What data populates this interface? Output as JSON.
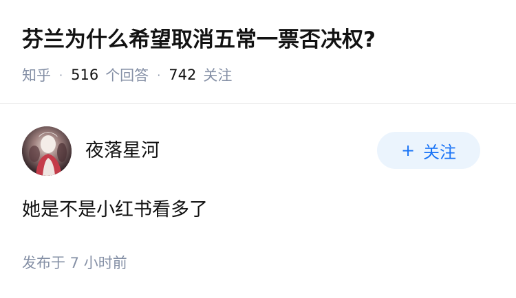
{
  "question": {
    "title": "芬兰为什么希望取消五常一票否决权?",
    "source": "知乎",
    "answer_count": "516",
    "answer_label": "个回答",
    "follow_count": "742",
    "follow_label": "关注",
    "separator": "·"
  },
  "answer": {
    "author_name": "夜落星河",
    "follow_button": {
      "icon": "+",
      "label": "关注"
    },
    "content": "她是不是小红书看多了",
    "publish_time": "发布于 7 小时前"
  },
  "colors": {
    "title": "#121212",
    "meta": "#8590a6",
    "accent": "#1772f6",
    "button_bg": "#ebf4fd"
  }
}
